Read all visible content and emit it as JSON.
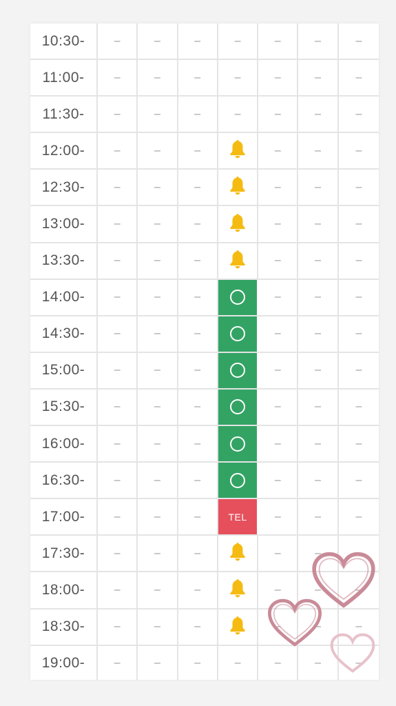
{
  "schedule": {
    "columns": 7,
    "colors": {
      "available": "#33a364",
      "tel": "#e6505c",
      "bell": "#f5bb12",
      "heart": "#c98b98"
    },
    "rows": [
      {
        "time": "10:30-",
        "slots": [
          "–",
          "–",
          "–",
          "–",
          "–",
          "–",
          "–"
        ]
      },
      {
        "time": "11:00-",
        "slots": [
          "–",
          "–",
          "–",
          "–",
          "–",
          "–",
          "–"
        ]
      },
      {
        "time": "11:30-",
        "slots": [
          "–",
          "–",
          "–",
          "–",
          "–",
          "–",
          "–"
        ]
      },
      {
        "time": "12:00-",
        "slots": [
          "–",
          "–",
          "–",
          "bell",
          "–",
          "–",
          "–"
        ]
      },
      {
        "time": "12:30-",
        "slots": [
          "–",
          "–",
          "–",
          "bell",
          "–",
          "–",
          "–"
        ]
      },
      {
        "time": "13:00-",
        "slots": [
          "–",
          "–",
          "–",
          "bell",
          "–",
          "–",
          "–"
        ]
      },
      {
        "time": "13:30-",
        "slots": [
          "–",
          "–",
          "–",
          "bell",
          "–",
          "–",
          "–"
        ]
      },
      {
        "time": "14:00-",
        "slots": [
          "–",
          "–",
          "–",
          "circle",
          "–",
          "–",
          "–"
        ]
      },
      {
        "time": "14:30-",
        "slots": [
          "–",
          "–",
          "–",
          "circle",
          "–",
          "–",
          "–"
        ]
      },
      {
        "time": "15:00-",
        "slots": [
          "–",
          "–",
          "–",
          "circle",
          "–",
          "–",
          "–"
        ]
      },
      {
        "time": "15:30-",
        "slots": [
          "–",
          "–",
          "–",
          "circle",
          "–",
          "–",
          "–"
        ]
      },
      {
        "time": "16:00-",
        "slots": [
          "–",
          "–",
          "–",
          "circle",
          "–",
          "–",
          "–"
        ]
      },
      {
        "time": "16:30-",
        "slots": [
          "–",
          "–",
          "–",
          "circle",
          "–",
          "–",
          "–"
        ]
      },
      {
        "time": "17:00-",
        "slots": [
          "–",
          "–",
          "–",
          "TEL",
          "–",
          "–",
          "–"
        ]
      },
      {
        "time": "17:30-",
        "slots": [
          "–",
          "–",
          "–",
          "bell",
          "–",
          "–",
          "–"
        ]
      },
      {
        "time": "18:00-",
        "slots": [
          "–",
          "–",
          "–",
          "bell",
          "–",
          "–",
          "–"
        ]
      },
      {
        "time": "18:30-",
        "slots": [
          "–",
          "–",
          "–",
          "bell",
          "–",
          "–",
          "–"
        ]
      },
      {
        "time": "19:00-",
        "slots": [
          "–",
          "–",
          "–",
          "–",
          "–",
          "–",
          "–"
        ]
      }
    ]
  },
  "decorations": {
    "icons": [
      "heart-icon",
      "heart-icon",
      "heart-icon"
    ]
  }
}
